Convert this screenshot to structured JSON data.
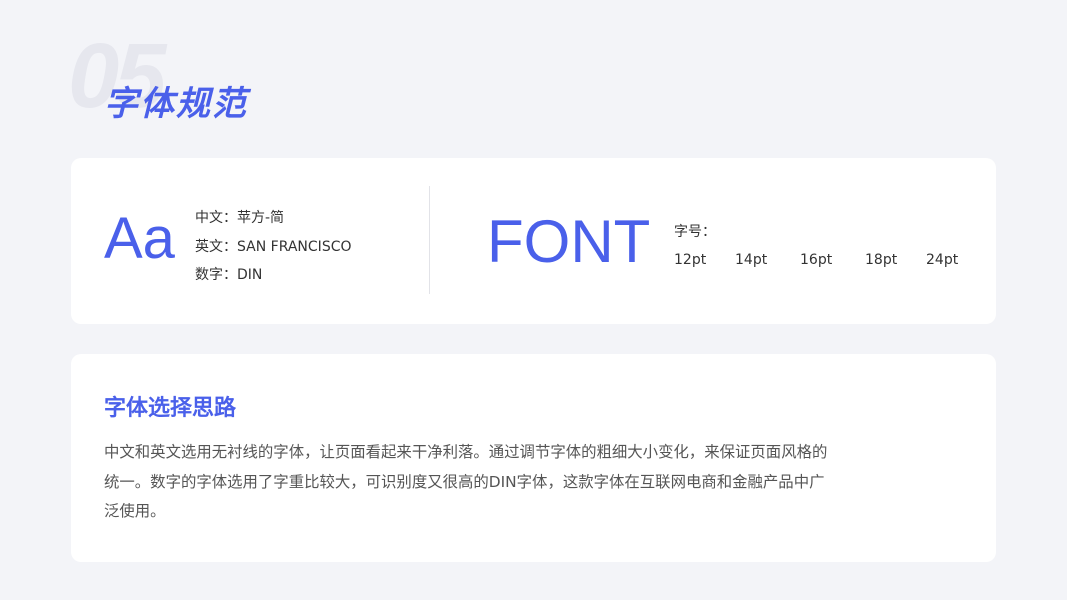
{
  "section": {
    "number": "05",
    "title": "字体规范"
  },
  "font_spec": {
    "sample_aa": "Aa",
    "fonts": [
      "中文：苹方-简",
      "英文：SAN FRANCISCO",
      "数字：DIN"
    ],
    "sample_font": "FONT",
    "size_label": "字号：",
    "sizes": [
      "12pt",
      "14pt",
      "16pt",
      "18pt",
      "24pt"
    ]
  },
  "thinking": {
    "title": "字体选择思路",
    "lines": [
      "中文和英文选用无衬线的字体，让页面看起来干净利落。通过调节字体的粗细大小变化，来保证页面风格的",
      "统一。数字的字体选用了字重比较大，可识别度又很高的DIN字体，这款字体在互联网电商和金融产品中广",
      "泛使用。"
    ]
  },
  "colors": {
    "accent": "#4a60ea",
    "background": "#f3f4f8",
    "card": "#ffffff",
    "watermark": "#e6e7ee"
  }
}
